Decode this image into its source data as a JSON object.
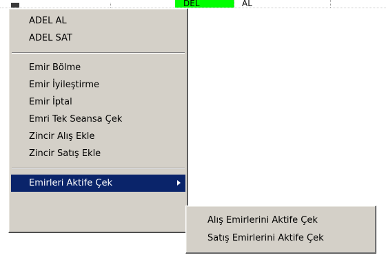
{
  "grid": {
    "cell_green_text": "DEL",
    "cell_side_text": "AL"
  },
  "context_menu": {
    "items": [
      {
        "label": "ADEL AL"
      },
      {
        "label": "ADEL SAT"
      },
      {
        "label": "Emir Bölme"
      },
      {
        "label": "Emir İyileştirme"
      },
      {
        "label": "Emir İptal"
      },
      {
        "label": "Emri Tek Seansa Çek"
      },
      {
        "label": "Zincir Alış Ekle"
      },
      {
        "label": "Zincir Satış Ekle"
      },
      {
        "label": "Emirleri Aktife Çek"
      }
    ]
  },
  "submenu": {
    "items": [
      {
        "label": "Alış Emirlerini Aktife Çek"
      },
      {
        "label": "Satış Emirlerini Aktife Çek"
      }
    ]
  },
  "colors": {
    "menu_background": "#d4d0c8",
    "highlight_background": "#0a246a",
    "highlight_text": "#ffffff",
    "grid_cell_highlight": "#00ff00"
  },
  "icons": {
    "submenu_indicator": "chevron-right-icon"
  }
}
